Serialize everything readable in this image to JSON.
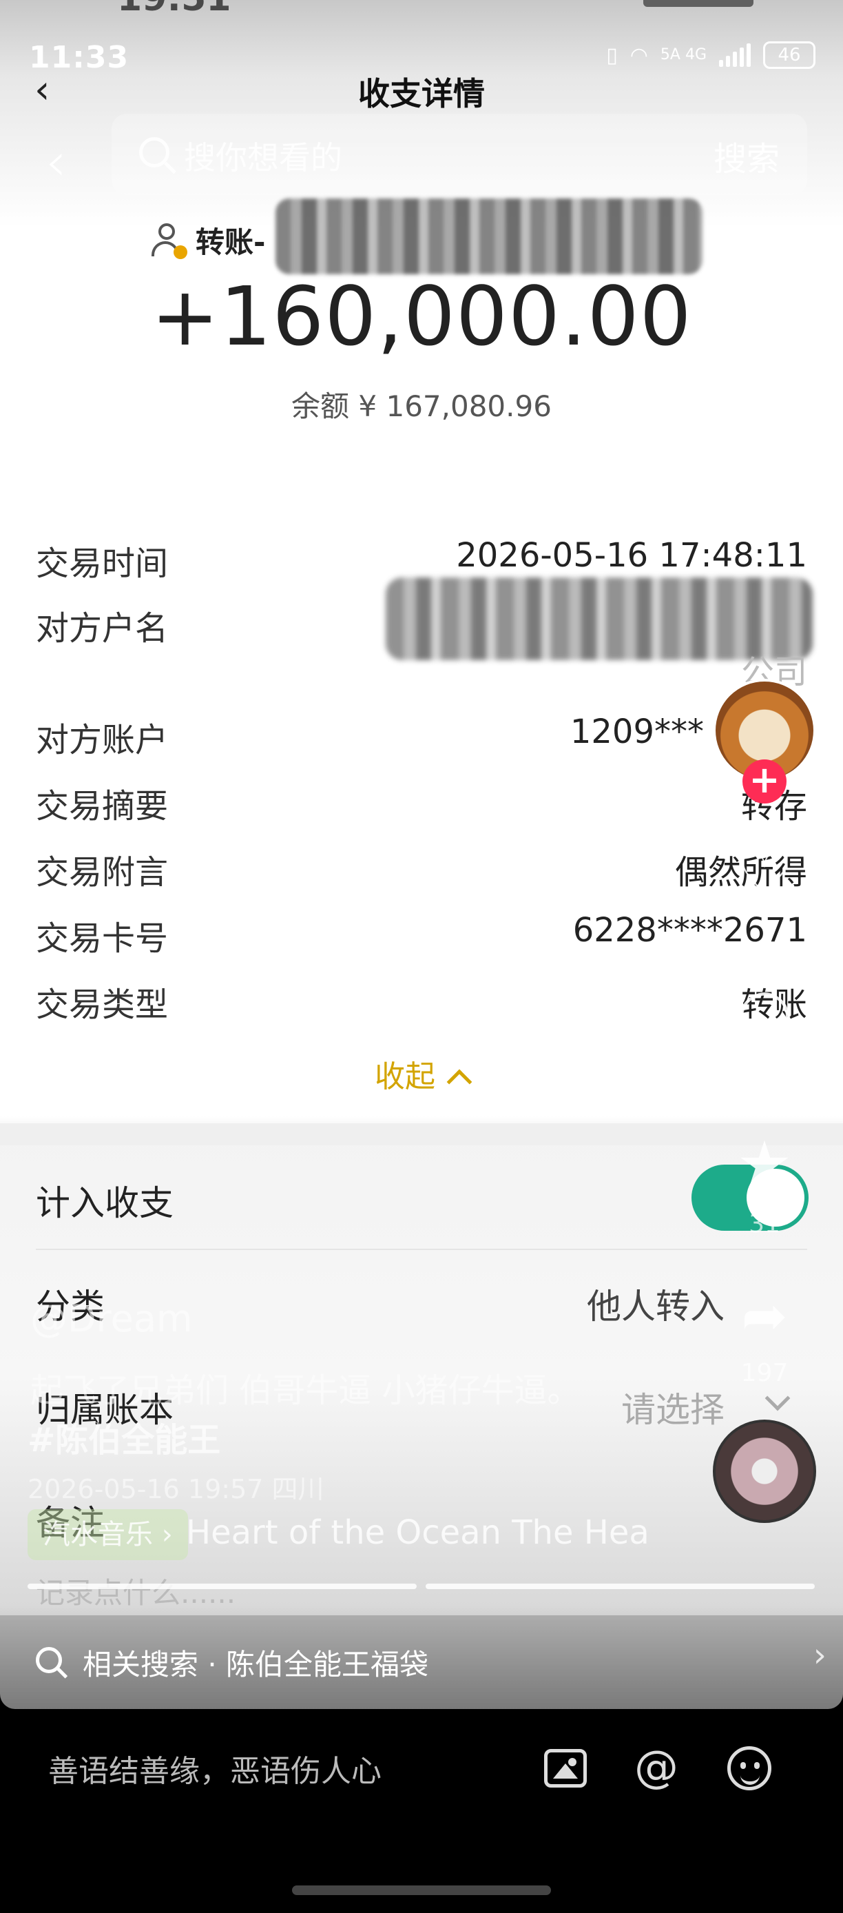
{
  "status_bar": {
    "time": "11:33",
    "network": "5A 4G",
    "battery": "46"
  },
  "nav": {
    "title": "收支详情",
    "back_icon": "chevron-left-icon"
  },
  "search_overlay": {
    "placeholder": "搜你想看的",
    "button_label": "搜索"
  },
  "header": {
    "party_label": "转账-",
    "amount": "+160,000.00",
    "balance": "余额 ¥ 167,080.96"
  },
  "details": {
    "rows": [
      {
        "label": "交易时间",
        "value": "2026-05-16 17:48:11"
      },
      {
        "label": "对方户名",
        "value": ""
      },
      {
        "label": "对方账户",
        "value": "1209***"
      },
      {
        "label": "交易摘要",
        "value": "转存"
      },
      {
        "label": "交易附言",
        "value": "偶然所得"
      },
      {
        "label": "交易卡号",
        "value": "6228****2671"
      },
      {
        "label": "交易类型",
        "value": "转账"
      }
    ],
    "company_tail": "公司",
    "collapse_label": "收起"
  },
  "bookkeeping": {
    "include_label": "计入收支",
    "include_on": true,
    "category_label": "分类",
    "category_value": "他人转入",
    "ledger_label": "归属账本",
    "ledger_value": "请选择",
    "note_label": "备注",
    "note_placeholder": "记录点什么......"
  },
  "video_overlay": {
    "author": "@Dream",
    "description": "起飞了兄弟们 伯哥牛逼 小猪仔牛逼。",
    "hashtag": "#陈伯全能王",
    "date_location": "2026-05-16 19:57 四川",
    "music_chip": "汽水音乐 ›",
    "music_title": "Heart of the Ocean  The Hea",
    "share_count": "197",
    "favorite_count": "31",
    "related_search": "相关搜索 · 陈伯全能王福袋"
  },
  "comment_bar": {
    "placeholder": "善语结善缘，恶语伤人心",
    "at_symbol": "@"
  },
  "colors": {
    "accent_gold": "#d3a400",
    "toggle_green": "#1dab8a",
    "plus_red": "#fe2c55"
  }
}
